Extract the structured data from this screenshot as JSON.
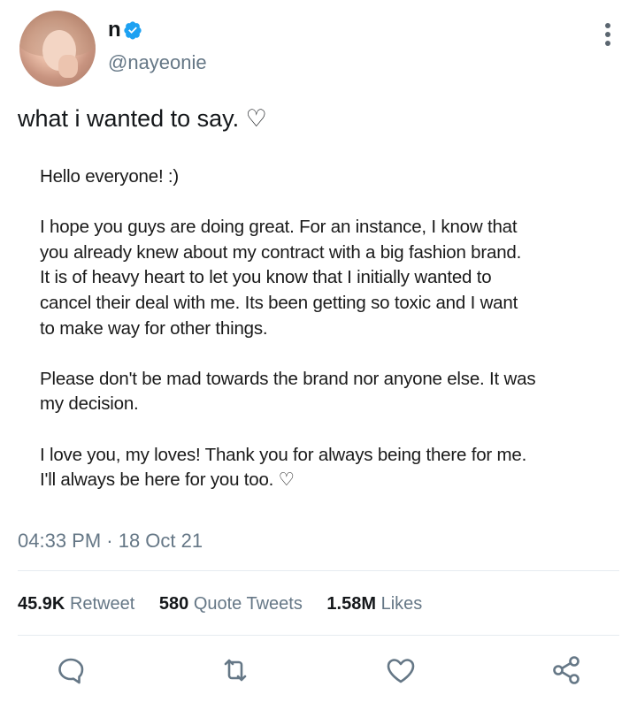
{
  "author": {
    "display_name": "n",
    "handle": "@nayeonie",
    "verified": true
  },
  "tweet": {
    "text": "what i wanted to say. ♡",
    "note_paragraphs": [
      "Hello everyone! :)",
      "I hope you guys are doing great. For an instance, I know that\nyou already knew about my contract with a  big fashion brand.\nIt is of heavy heart to let you know that I initially wanted to\ncancel their deal with me. Its been getting so toxic and I want\nto make way for other things.",
      "Please don't be mad towards the brand nor anyone else. It was\nmy decision.",
      "I love you, my loves! Thank you for always being there for me.\nI'll always be here for you too. ♡"
    ],
    "timestamp": "04:33 PM · 18 Oct 21"
  },
  "stats": {
    "retweets_count": "45.9K",
    "retweets_label": "Retweet",
    "quotes_count": "580",
    "quotes_label": "Quote Tweets",
    "likes_count": "1.58M",
    "likes_label": "Likes"
  },
  "icons": {
    "reply": "reply-icon",
    "retweet": "retweet-icon",
    "like": "heart-icon",
    "share": "share-icon",
    "more": "more-vertical-icon",
    "verified": "verified-badge-icon"
  },
  "colors": {
    "verified_blue": "#1da1f2",
    "icon_gray": "#657786",
    "secondary_text": "#657786"
  }
}
